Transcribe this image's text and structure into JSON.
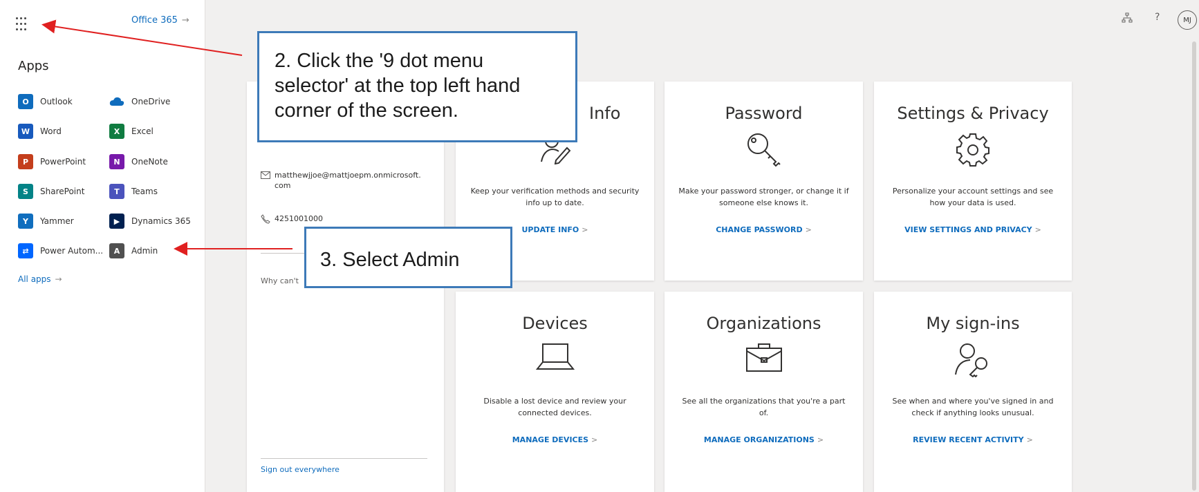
{
  "left_panel": {
    "office365_label": "Office 365",
    "office365_arrow": "→",
    "apps_title": "Apps",
    "apps": [
      {
        "label": "Outlook",
        "icon": "outlook-icon",
        "letter": "O",
        "color": "#0f6cbd"
      },
      {
        "label": "OneDrive",
        "icon": "onedrive-icon",
        "letter": "",
        "color": "#0f6cbd"
      },
      {
        "label": "Word",
        "icon": "word-icon",
        "letter": "W",
        "color": "#185abd"
      },
      {
        "label": "Excel",
        "icon": "excel-icon",
        "letter": "X",
        "color": "#107c41"
      },
      {
        "label": "PowerPoint",
        "icon": "powerpoint-icon",
        "letter": "P",
        "color": "#c43e1c"
      },
      {
        "label": "OneNote",
        "icon": "onenote-icon",
        "letter": "N",
        "color": "#7719aa"
      },
      {
        "label": "SharePoint",
        "icon": "sharepoint-icon",
        "letter": "S",
        "color": "#038387"
      },
      {
        "label": "Teams",
        "icon": "teams-icon",
        "letter": "T",
        "color": "#4b53bc"
      },
      {
        "label": "Yammer",
        "icon": "yammer-icon",
        "letter": "Y",
        "color": "#106ebe"
      },
      {
        "label": "Dynamics 365",
        "icon": "dynamics-icon",
        "letter": "▶",
        "color": "#002050"
      },
      {
        "label": "Power Autom...",
        "icon": "power-automate-icon",
        "letter": "⇄",
        "color": "#0066ff"
      },
      {
        "label": "Admin",
        "icon": "admin-icon",
        "letter": "A",
        "color": "#505050"
      }
    ],
    "all_apps_label": "All apps",
    "all_apps_arrow": "→"
  },
  "header": {
    "org_icon": "org-chart-icon",
    "help_label": "?",
    "avatar_initials": "MJ"
  },
  "profile": {
    "email": "matthewjjoe@mattjoepm.onmicrosoft.com",
    "email_line1": "matthewjjoe@mattjoepm.onmicrosoft.",
    "email_line2": "com",
    "phone": "4251001000",
    "why_cant": "Why can't",
    "sign_out_everywhere": "Sign out everywhere"
  },
  "cards": [
    {
      "title": "Info",
      "icon": "user-edit-icon",
      "desc": "Keep your verification methods and security info up to date.",
      "link": "UPDATE INFO"
    },
    {
      "title": "Password",
      "icon": "key-icon",
      "desc": "Make your password stronger, or change it if someone else knows it.",
      "link": "CHANGE PASSWORD"
    },
    {
      "title": "Settings & Privacy",
      "icon": "gear-icon",
      "desc": "Personalize your account settings and see how your data is used.",
      "link": "VIEW SETTINGS AND PRIVACY"
    },
    {
      "title": "Devices",
      "icon": "laptop-icon",
      "desc": "Disable a lost device and review your connected devices.",
      "link": "MANAGE DEVICES"
    },
    {
      "title": "Organizations",
      "icon": "briefcase-icon",
      "desc": "See all the organizations that you're a part of.",
      "link": "MANAGE ORGANIZATIONS"
    },
    {
      "title": "My sign-ins",
      "icon": "user-key-icon",
      "desc": "See when and where you've signed in and check if anything looks unusual.",
      "link": "REVIEW RECENT ACTIVITY"
    }
  ],
  "card_chevron": ">",
  "callouts": {
    "step2": "2. Click the '9 dot menu selector' at the top left hand corner of the screen.",
    "step3": "3. Select Admin"
  },
  "colors": {
    "link_blue": "#0f6cbd",
    "callout_border": "#3d7ab8",
    "arrow_red": "#e02020"
  }
}
